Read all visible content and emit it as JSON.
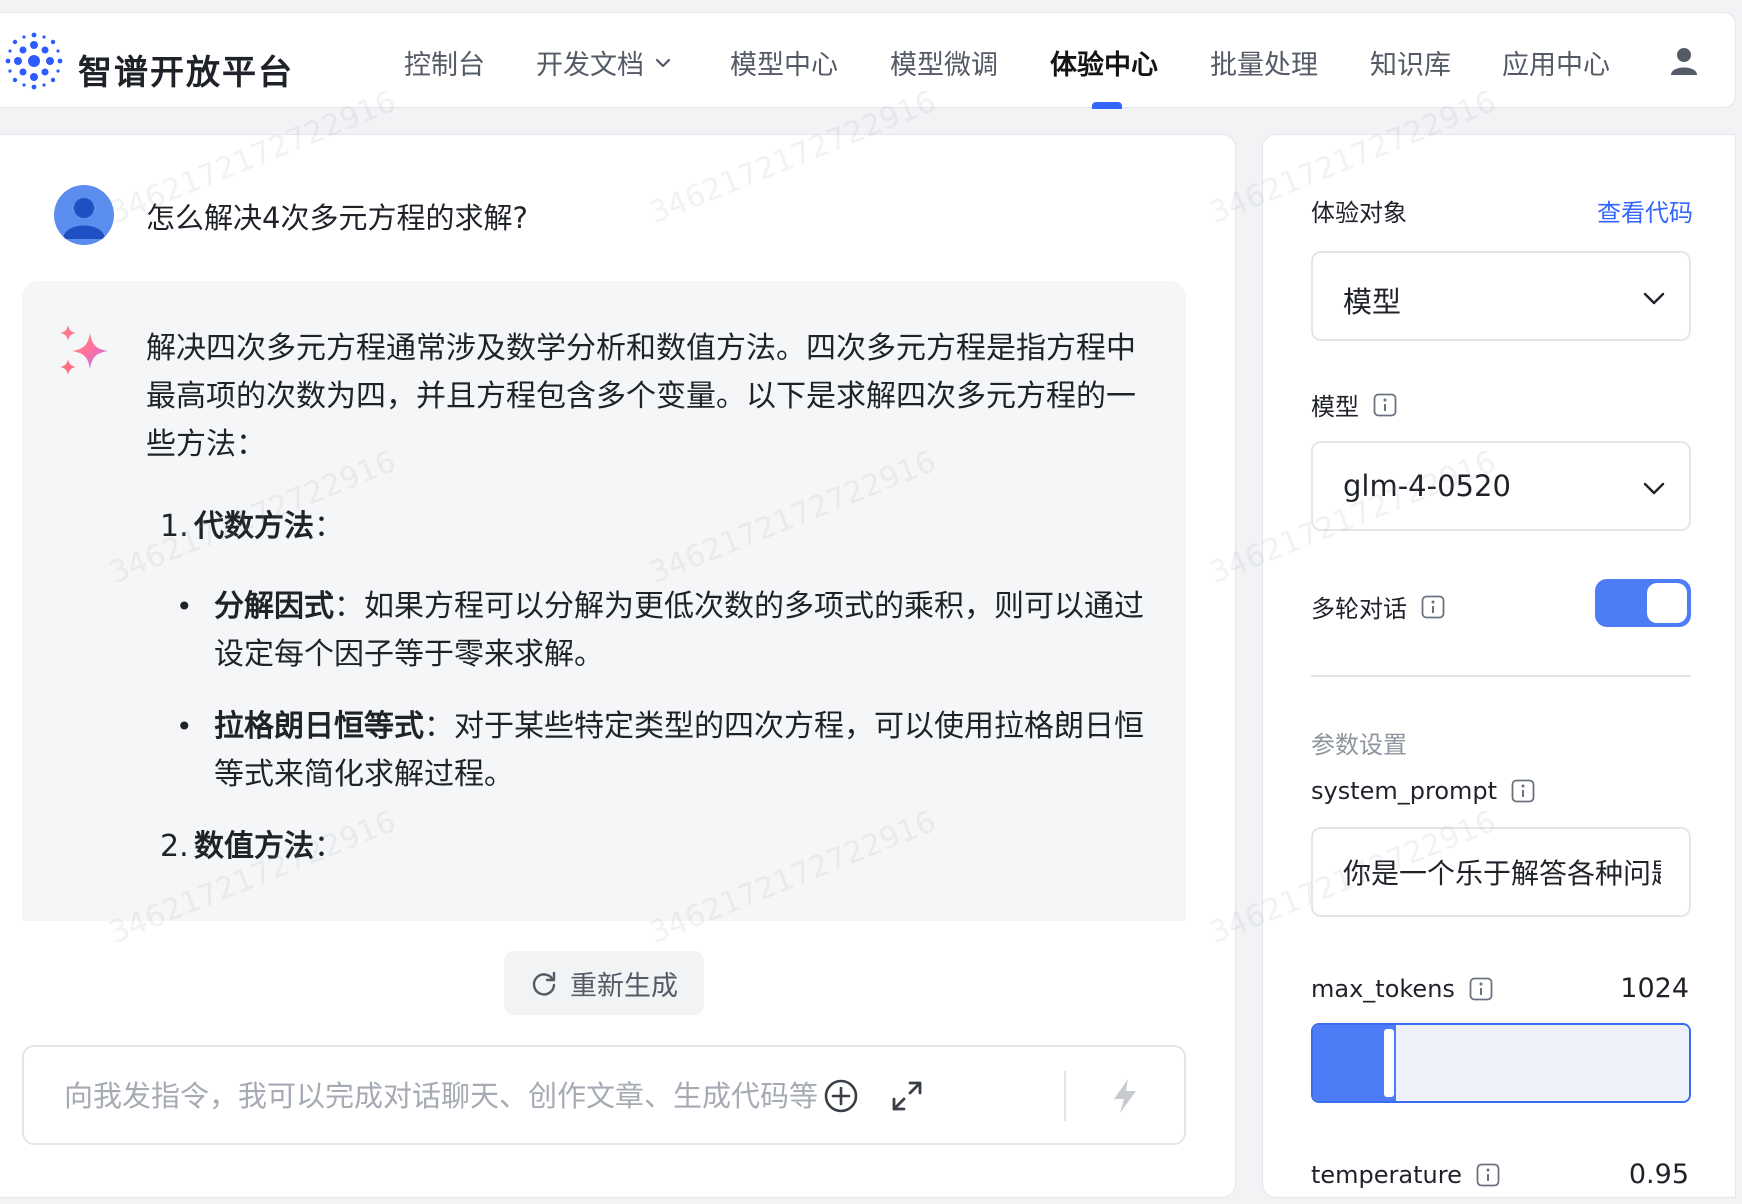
{
  "brand": {
    "name": "智谱开放平台"
  },
  "nav": {
    "items": [
      "控制台",
      "开发文档",
      "模型中心",
      "模型微调",
      "体验中心",
      "批量处理",
      "知识库",
      "应用中心"
    ],
    "active": "体验中心"
  },
  "chat": {
    "user_message": "怎么解决4次多元方程的求解?",
    "answer": {
      "intro": "解决四次多元方程通常涉及数学分析和数值方法。四次多元方程是指方程中最高项的次数为四，并且方程包含多个变量。以下是求解四次多元方程的一些方法：",
      "sections": [
        {
          "num": "1.",
          "title": "代数方法",
          "bullets": [
            {
              "term": "分解因式",
              "text": "如果方程可以分解为更低次数的多项式的乘积，则可以通过设定每个因子等于零来求解。"
            },
            {
              "term": "拉格朗日恒等式",
              "text": "对于某些特定类型的四次方程，可以使用拉格朗日恒等式来简化求解过程。"
            }
          ]
        },
        {
          "num": "2.",
          "title": "数值方法"
        }
      ]
    },
    "regenerate_label": "重新生成",
    "input_placeholder": "向我发指令，我可以完成对话聊天、创作文章、生成代码等"
  },
  "settings": {
    "target_label": "体验对象",
    "view_code": "查看代码",
    "target_value": "模型",
    "model_label": "模型",
    "model_value": "glm-4-0520",
    "multi_turn_label": "多轮对话",
    "multi_turn_on": true,
    "params_title": "参数设置",
    "system_prompt_label": "system_prompt",
    "system_prompt_value": "你是一个乐于解答各种问题的助手",
    "max_tokens_label": "max_tokens",
    "max_tokens_value": "1024",
    "max_tokens_fraction": 0.22,
    "temperature_label": "temperature",
    "temperature_value": "0.95"
  },
  "watermark": "3462172172722916"
}
